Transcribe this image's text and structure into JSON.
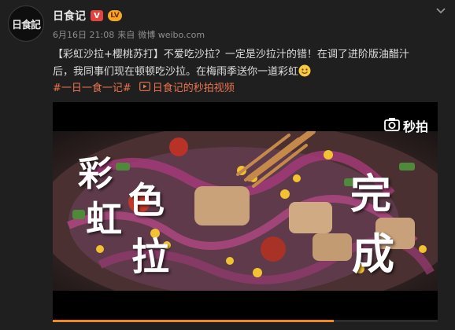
{
  "post": {
    "avatar_text": "日食記",
    "username": "日食记",
    "vip_badge": "V",
    "level_badge": "LV",
    "date": "6月16日 21:08",
    "source_prefix": "来自",
    "source": "微博 weibo.com",
    "text_line1": "【彩虹沙拉+樱桃苏打】不爱吃沙拉？一定是沙拉汁的错！在调了进阶版油醋汁",
    "text_line2": "后，我同事们现在顿顿吃沙拉。在梅雨季送你一道彩虹",
    "emoji": "smile-emoji",
    "hashtag": "#一日一食一记#",
    "video_link": "日食记的秒拍视频"
  },
  "video": {
    "watermark": "秒拍",
    "title_left": [
      "彩",
      "虹",
      "色",
      "拉"
    ],
    "title_right": [
      "完",
      "成"
    ],
    "progress": 0.73
  },
  "colors": {
    "background": "#1f1f1f",
    "link": "#eb7350",
    "progress": "#f08a1a"
  }
}
